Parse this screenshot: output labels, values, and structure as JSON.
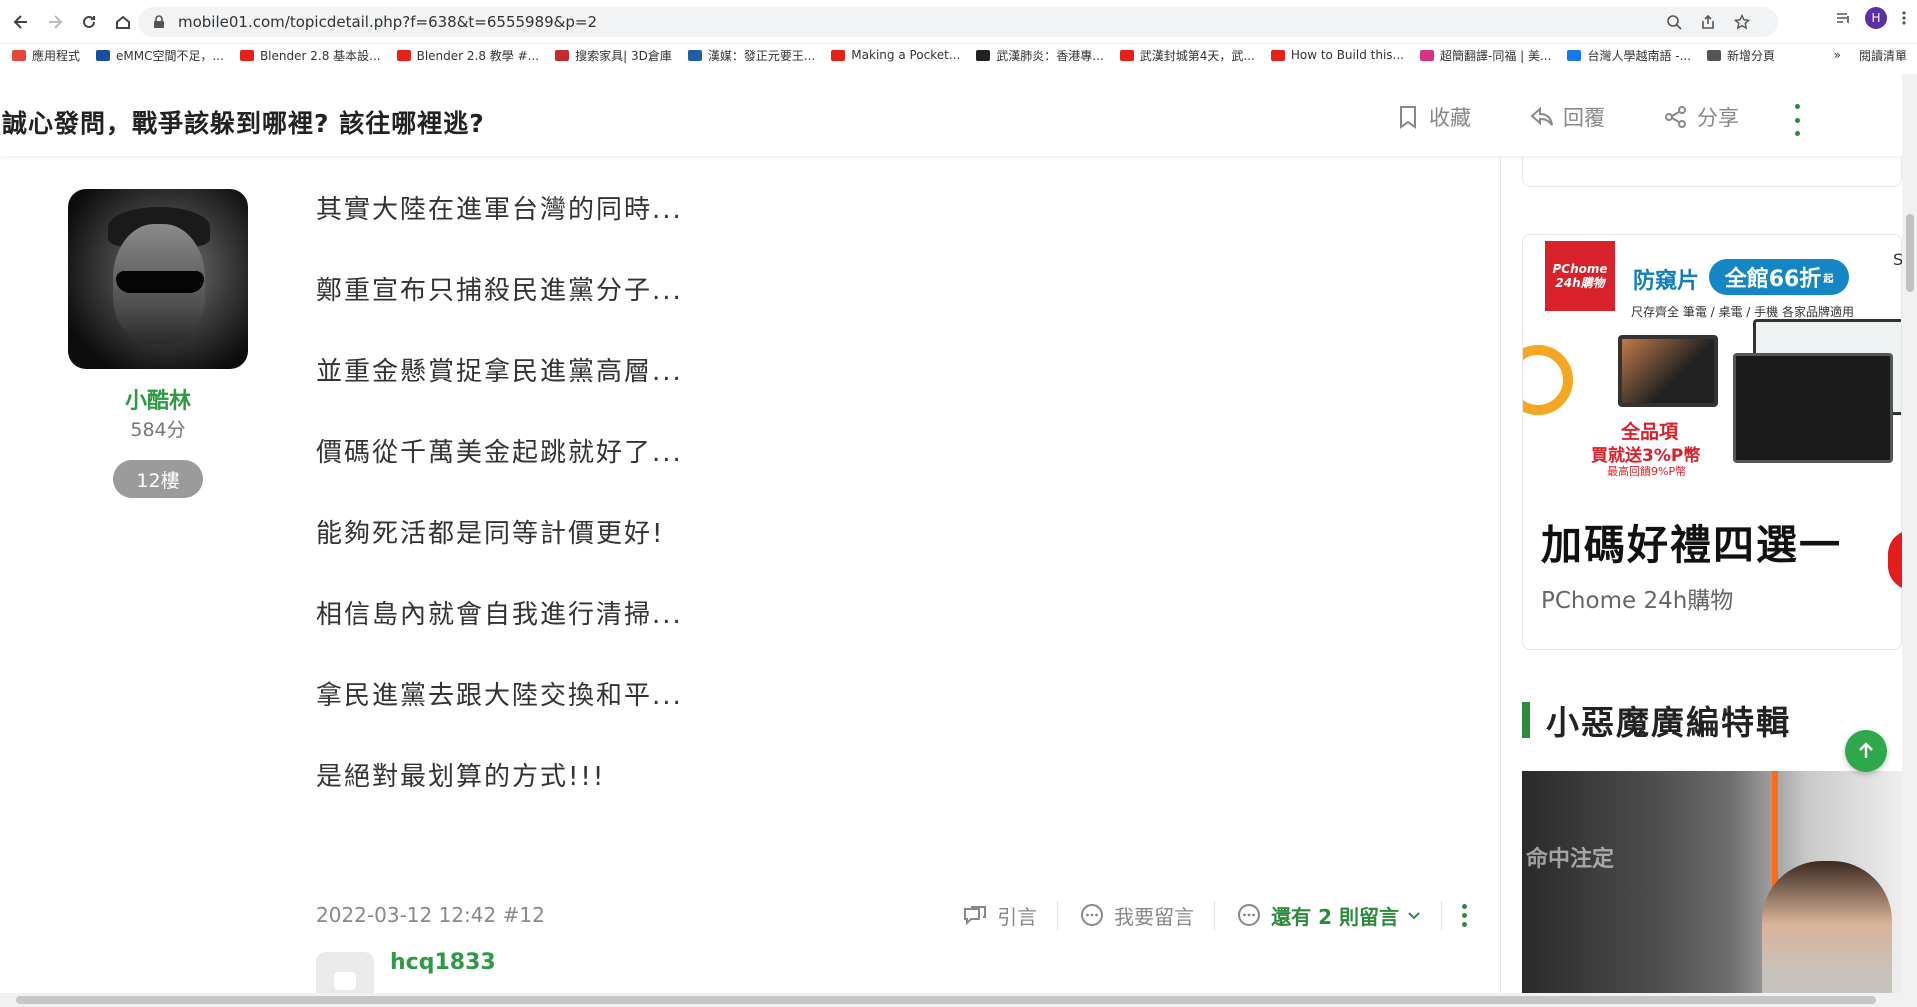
{
  "browser": {
    "url": "mobile01.com/topicdetail.php?f=638&t=6555989&p=2",
    "profile_initial": "H",
    "bookmarks": [
      {
        "label": "應用程式",
        "color": "#e8453c"
      },
      {
        "label": "eMMC空間不足，...",
        "color": "#1a4fa0"
      },
      {
        "label": "Blender 2.8 基本設...",
        "color": "#e62117"
      },
      {
        "label": "Blender 2.8 教學 #...",
        "color": "#e62117"
      },
      {
        "label": "搜索家具| 3D倉庫",
        "color": "#c62a2a"
      },
      {
        "label": "漢媒：發正元要王...",
        "color": "#1d5fa8"
      },
      {
        "label": "Making a Pocket...",
        "color": "#e62117"
      },
      {
        "label": "武漢肺炎：香港專...",
        "color": "#222222"
      },
      {
        "label": "武漢封城第4天，武...",
        "color": "#e62117"
      },
      {
        "label": "How to Build this...",
        "color": "#e62117"
      },
      {
        "label": "超簡翻譯-同福 | 美...",
        "color": "#d63384"
      },
      {
        "label": "台灣人學越南語 -...",
        "color": "#1877f2"
      },
      {
        "label": "新增分頁",
        "color": "#555555"
      }
    ],
    "bookmarks_more": "»",
    "reading_list": "閱讀清單"
  },
  "topic": {
    "title": "誠心發問，戰爭該躲到哪裡? 該往哪裡逃?",
    "actions": {
      "favorite": "收藏",
      "reply": "回覆",
      "share": "分享"
    }
  },
  "post": {
    "author": "小酷林",
    "score": "584分",
    "floor": "12樓",
    "lines": [
      "其實大陸在進軍台灣的同時...",
      "鄭重宣布只捕殺民進黨分子...",
      "並重金懸賞捉拿民進黨高層...",
      "價碼從千萬美金起跳就好了...",
      "能夠死活都是同等計價更好!",
      "相信島內就會自我進行清掃...",
      "拿民進黨去跟大陸交換和平...",
      "是絕對最划算的方式!!!"
    ],
    "datetime": "2022-03-12 12:42 #12",
    "actions": {
      "quote": "引言",
      "comment": "我要留言",
      "more_comments": "還有 2 則留言"
    }
  },
  "reply": {
    "author": "hcq1833"
  },
  "sidebar": {
    "ad": {
      "logo_line1": "PChome",
      "logo_line2": "24h購物",
      "headline": "防窺片",
      "pill": "全館66折",
      "pill_suffix": "起",
      "sub": "尺存齊全 筆電 / 桌電 / 手機 各家品牌適用",
      "promo1": "全品項",
      "promo2": "買就送3%P幣",
      "promo3": "最高回饋9%P幣",
      "title": "加碼好禮四選一",
      "brand": "PChome 24h購物",
      "edge_text": "S"
    },
    "section_title": "小惡魔廣編特輯",
    "video_text": "命中注定"
  },
  "colors": {
    "brand_green": "#2d8a3c",
    "username_green": "#2e9a43"
  }
}
